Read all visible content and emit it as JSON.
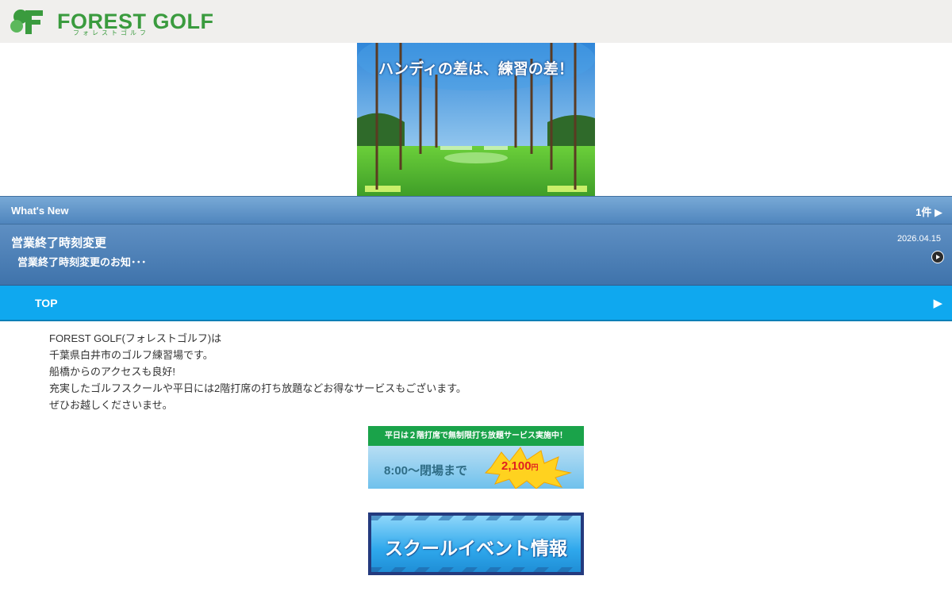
{
  "header": {
    "logo_text": "FOREST GOLF",
    "logo_sub": "フォレストゴルフ"
  },
  "hero": {
    "caption": "ハンディの差は、練習の差！"
  },
  "news": {
    "header_title": "What's New",
    "count": "1件 ▶",
    "items": [
      {
        "title": "営業終了時刻変更",
        "snippet": "営業終了時刻変更のお知･･･",
        "date": "2026.04.15"
      }
    ]
  },
  "nav": {
    "top_label": "TOP",
    "top_arrow": "▶"
  },
  "intro": {
    "lines": [
      "FOREST GOLF(フォレストゴルフ)は",
      "千葉県白井市のゴルフ練習場です。",
      "船橋からのアクセスも良好!",
      "充実したゴルフスクールや平日には2階打席の打ち放題などお得なサービスもございます。",
      "ぜひお越しくださいませ。"
    ]
  },
  "promo": {
    "headline": "平日は２階打席で無制限打ち放題サービス実施中！",
    "time": "8:00～閉場まで",
    "price": "2,100",
    "yen": "円"
  },
  "event": {
    "label": "スクールイベント情報"
  },
  "colors": {
    "brand_green": "#3a9b3e",
    "news_blue": "#4f85bd",
    "nav_cyan": "#0fa8ef"
  }
}
